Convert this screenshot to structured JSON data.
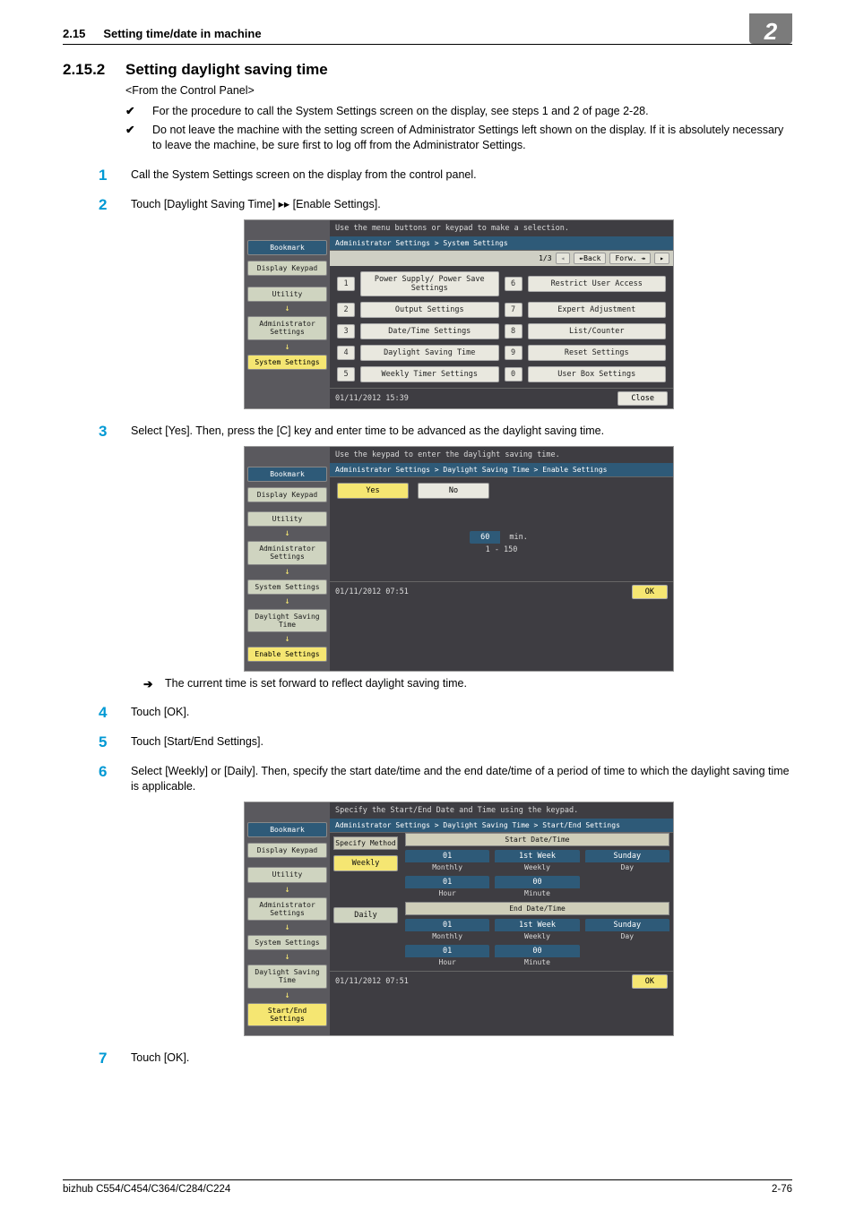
{
  "header": {
    "num": "2.15",
    "title": "Setting time/date in machine",
    "badge": "2"
  },
  "section": {
    "num": "2.15.2",
    "title": "Setting daylight saving time",
    "subtitle": "<From the Control Panel>",
    "checks": [
      "For the procedure to call the System Settings screen on the display, see steps 1 and 2 of page 2-28.",
      "Do not leave the machine with the setting screen of Administrator Settings left shown on the display. If it is absolutely necessary to leave the machine, be sure first to log off from the Administrator Settings."
    ]
  },
  "steps": {
    "s1": "Call the System Settings screen on the display from the control panel.",
    "s2": "Touch [Daylight Saving Time] ▸▸ [Enable Settings].",
    "s3": "Select [Yes]. Then, press the [C] key and enter time to be advanced as the daylight saving time.",
    "s3_sub": "The current time is set forward to reflect daylight saving time.",
    "s4": "Touch [OK].",
    "s5": "Touch [Start/End Settings].",
    "s6": "Select [Weekly] or [Daily]. Then, specify the start date/time and the end date/time of a period of time to which the daylight saving time is applicable.",
    "s7": "Touch [OK]."
  },
  "screenshot1": {
    "top": "Use the menu buttons or keypad to make a selection.",
    "side": [
      "Bookmark",
      "Display Keypad",
      "Utility",
      "Administrator Settings",
      "System Settings"
    ],
    "crumb": "Administrator Settings > System Settings",
    "page_label": "1/3",
    "back": "↞Back",
    "forw": "Forw. ↠",
    "items": {
      "1": "Power Supply/\nPower Save Settings",
      "2": "Output Settings",
      "3": "Date/Time Settings",
      "4": "Daylight Saving Time",
      "5": "Weekly Timer Settings",
      "6": "Restrict User Access",
      "7": "Expert Adjustment",
      "8": "List/Counter",
      "9": "Reset Settings",
      "0": "User Box Settings"
    },
    "footer_dt": "01/11/2012   15:39",
    "close": "Close"
  },
  "screenshot2": {
    "top": "Use the keypad to enter the daylight saving time.",
    "side": [
      "Bookmark",
      "Display Keypad",
      "Utility",
      "Administrator Settings",
      "System Settings",
      "Daylight Saving Time",
      "Enable Settings"
    ],
    "crumb": "Administrator Settings > Daylight Saving Time > Enable Settings",
    "yes": "Yes",
    "no": "No",
    "value": "60",
    "unit": "min.",
    "range": "1  -  150",
    "footer_dt": "01/11/2012   07:51",
    "ok": "OK"
  },
  "screenshot3": {
    "top": "Specify the Start/End Date and Time using the keypad.",
    "side": [
      "Bookmark",
      "Display Keypad",
      "Utility",
      "Administrator Settings",
      "System Settings",
      "Daylight Saving Time",
      "Start/End Settings"
    ],
    "crumb": "Administrator Settings > Daylight Saving Time > Start/End Settings",
    "header_left": "Specify Method",
    "header_right": "Start Date/Time",
    "method_weekly": "Weekly",
    "method_daily": "Daily",
    "start": {
      "c1v": "01",
      "c1l": "Monthly",
      "c2v": "1st Week",
      "c2l": "Weekly",
      "c3v": "Sunday",
      "c3l": "Day",
      "r2c1v": "01",
      "r2c1l": "Hour",
      "r2c2v": "00",
      "r2c2l": "Minute"
    },
    "end_header": "End Date/Time",
    "end": {
      "c1v": "01",
      "c1l": "Monthly",
      "c2v": "1st Week",
      "c2l": "Weekly",
      "c3v": "Sunday",
      "c3l": "Day",
      "r2c1v": "01",
      "r2c1l": "Hour",
      "r2c2v": "00",
      "r2c2l": "Minute"
    },
    "footer_dt": "01/11/2012   07:51",
    "ok": "OK"
  },
  "footer": {
    "left": "bizhub C554/C454/C364/C284/C224",
    "right": "2-76"
  }
}
